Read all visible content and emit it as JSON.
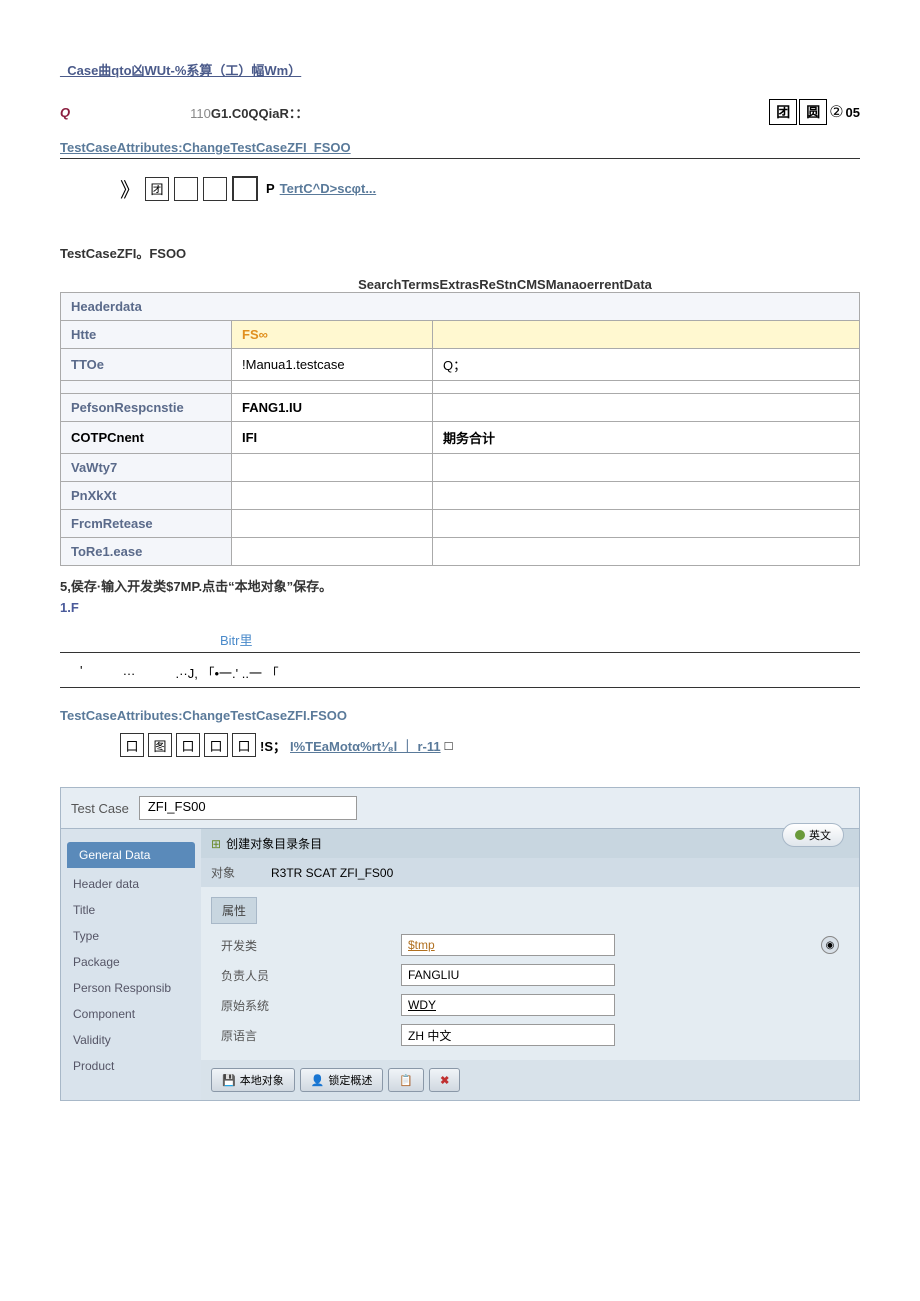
{
  "topLink": "_Case曲qto凶WUt-%系算（工）幅Wm）",
  "qLabel": "Q",
  "code1_prefix": "110",
  "code1_main": "G1.C0QQiaR：：",
  "badges": {
    "b1": "团",
    "b2": "圆",
    "circle": "②",
    "suffix": "05"
  },
  "subtitle1": "TestCaseAttributes:ChangeTestCaseZFI_FSOO",
  "toolbar1": {
    "glyph1": "》",
    "icon1": "团",
    "p": "P",
    "link": "TertC^D>scφt..."
  },
  "heading1": "TestCaseZFI。FSOO",
  "tabRow": "SearchTermsExtrasReStnCMSManaoerrentData",
  "table": {
    "header": "Headerdata",
    "rows": [
      {
        "label": "Htte",
        "v1": "FS∞",
        "v2": "",
        "hl": true
      },
      {
        "label": "TTOe",
        "v1": "!Manua1.testcase",
        "v2": "Q；",
        "hl": false
      },
      {
        "label": "",
        "v1": "",
        "v2": "",
        "hl": false
      },
      {
        "label": "PefsonRespcnstie",
        "v1": "FANG1.IU",
        "v2": "",
        "hl": false,
        "bold": true
      },
      {
        "label": "COTPCnent",
        "v1": "IFI",
        "v2": "期务合计",
        "hl": false,
        "bold": true,
        "boldlabel": true
      },
      {
        "label": "VaWty7",
        "v1": "",
        "v2": "",
        "hl": false
      },
      {
        "label": "PnXkXt",
        "v1": "",
        "v2": "",
        "hl": false
      },
      {
        "label": "FrcmRetease",
        "v1": "",
        "v2": "",
        "hl": false
      },
      {
        "label": "ToRe1.ease",
        "v1": "",
        "v2": "",
        "hl": false
      }
    ]
  },
  "narrative": "5,侯存·输入开发类$7MP.点击“本地对象”保存。",
  "step": "1.F",
  "bitr": "Bitr里",
  "dotsLeft": "'",
  "dotsMid": "…",
  "dotsRight": ".··J,  「•一.'   ..一  「",
  "subtitle2": "TestCaseAttributes:ChangeTestCaseZFI.FSOO",
  "toolbar2": {
    "icon1": "口",
    "icon2": "图",
    "icon3": "口",
    "icon4": "口",
    "icon5": "口",
    "text1": "!S；",
    "link1": "I%TEaMotα%rt¹⁄₈l ｜ r-11",
    "suffix": "□"
  },
  "sap": {
    "testCaseLabel": "Test Case",
    "testCaseValue": "ZFI_FS00",
    "langBtn": "英文",
    "sidebar": {
      "tab1": "General Data",
      "items": [
        "Header data",
        "Title",
        "Type",
        "Package",
        "Person Responsib",
        "Component",
        "Validity",
        "Product"
      ]
    },
    "dialog": {
      "title": "创建对象目录条目",
      "objLabel": "对象",
      "objValue": "R3TR SCAT ZFI_FS00",
      "attrSection": "属性",
      "rows": [
        {
          "label": "开发类",
          "value": "$tmp",
          "hl": true,
          "picker": true
        },
        {
          "label": "负责人员",
          "value": "FANGLIU",
          "hl": false
        },
        {
          "label": "原始系统",
          "value": "WDY",
          "hl": false,
          "under": true
        },
        {
          "label": "原语言",
          "value": "ZH 中文",
          "hl": false
        }
      ],
      "buttons": {
        "b1": "本地对象",
        "b2": "锁定概述"
      }
    }
  }
}
